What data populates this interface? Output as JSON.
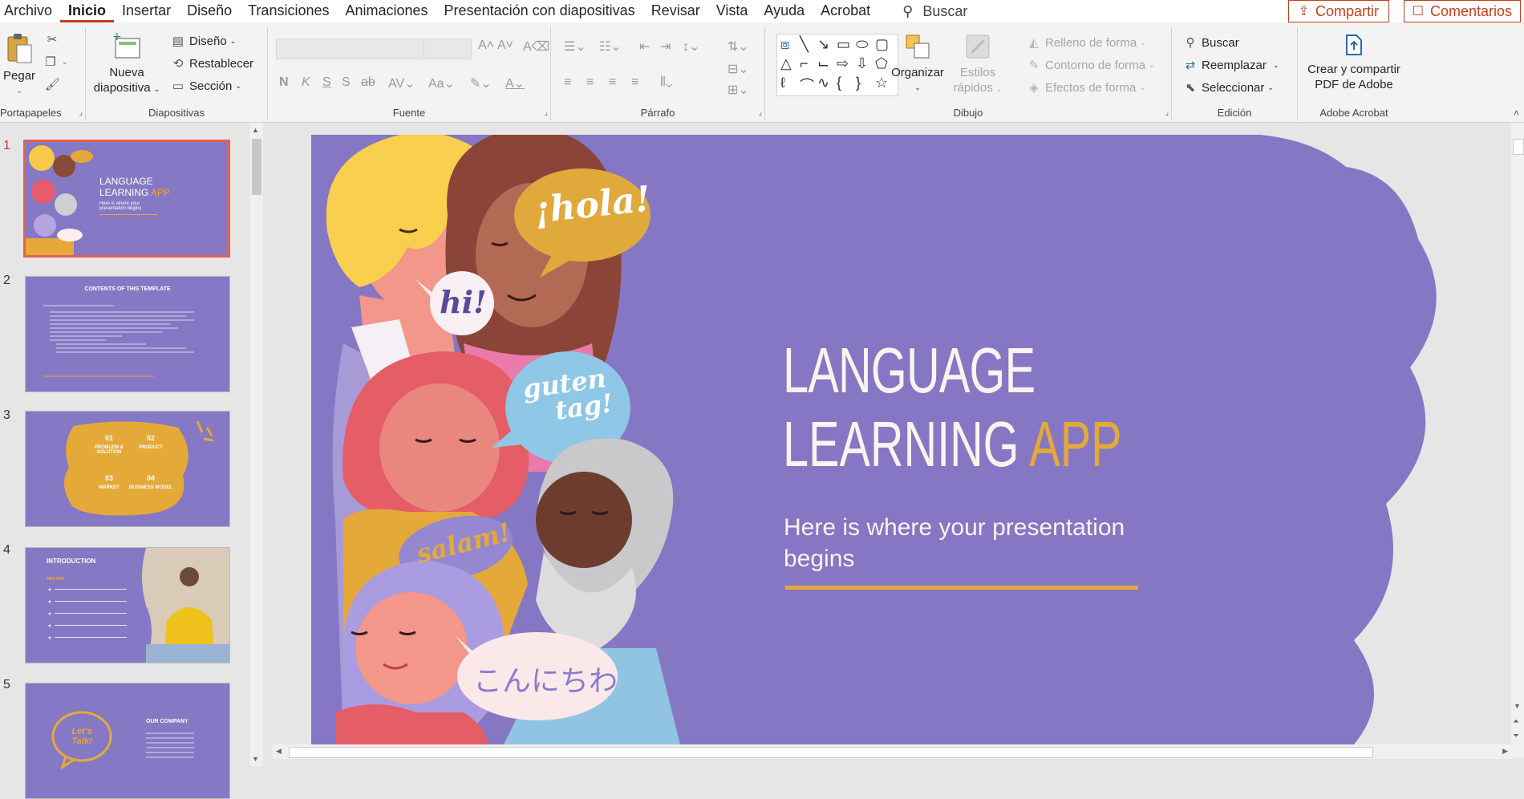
{
  "menu": {
    "tabs": [
      "Archivo",
      "Inicio",
      "Insertar",
      "Diseño",
      "Transiciones",
      "Animaciones",
      "Presentación con diapositivas",
      "Revisar",
      "Vista",
      "Ayuda",
      "Acrobat"
    ],
    "active_index": 1,
    "search_label": "Buscar",
    "share_label": "Compartir",
    "comments_label": "Comentarios"
  },
  "ribbon": {
    "clipboard": {
      "paste": "Pegar",
      "label": "Portapapeles"
    },
    "slides": {
      "new_slide_line1": "Nueva",
      "new_slide_line2": "diapositiva",
      "layout": "Diseño",
      "reset": "Restablecer",
      "section": "Sección",
      "label": "Diapositivas"
    },
    "font": {
      "label": "Fuente"
    },
    "paragraph": {
      "label": "Párrafo"
    },
    "drawing": {
      "arrange": "Organizar",
      "styles_line1": "Estilos",
      "styles_line2": "rápidos",
      "fill": "Relleno de forma",
      "outline": "Contorno de forma",
      "effects": "Efectos de forma",
      "label": "Dibujo"
    },
    "editing": {
      "find": "Buscar",
      "replace": "Reemplazar",
      "select": "Seleccionar",
      "label": "Edición"
    },
    "acrobat": {
      "line1": "Crear y compartir",
      "line2": "PDF de Adobe",
      "label": "Adobe Acrobat"
    }
  },
  "thumbnails": {
    "numbers": [
      "1",
      "2",
      "3",
      "4",
      "5"
    ],
    "t1": {
      "title_line1": "LANGUAGE",
      "title_line2": "LEARNING",
      "accent": "APP",
      "subtitle": "Here is where your presentation begins"
    },
    "t2": {
      "title": "CONTENTS OF THIS TEMPLATE"
    },
    "t3": {
      "n1": "01",
      "n2": "02",
      "n3": "03",
      "n4": "04",
      "l1": "PROBLEM & SOLUTION",
      "l2": "PRODUCT",
      "l3": "MARKET",
      "l4": "BUSINESS MODEL"
    },
    "t4": {
      "title": "INTRODUCTION",
      "sub": "MEETING"
    },
    "t5": {
      "title": "OUR COMPANY",
      "badge": "Let's Talk!"
    }
  },
  "slide": {
    "title_line1": "LANGUAGE",
    "title_line2": "LEARNING",
    "title_accent": "APP",
    "subtitle": "Here is where your presentation begins",
    "bubbles": {
      "hola": "¡hola!",
      "hi": "hi!",
      "guten": "guten",
      "tag": "tag!",
      "salam": "salam!",
      "konnichiwa": "こんにちわ"
    },
    "colors": {
      "background": "#8577c3",
      "accent": "#e5a93a"
    }
  }
}
